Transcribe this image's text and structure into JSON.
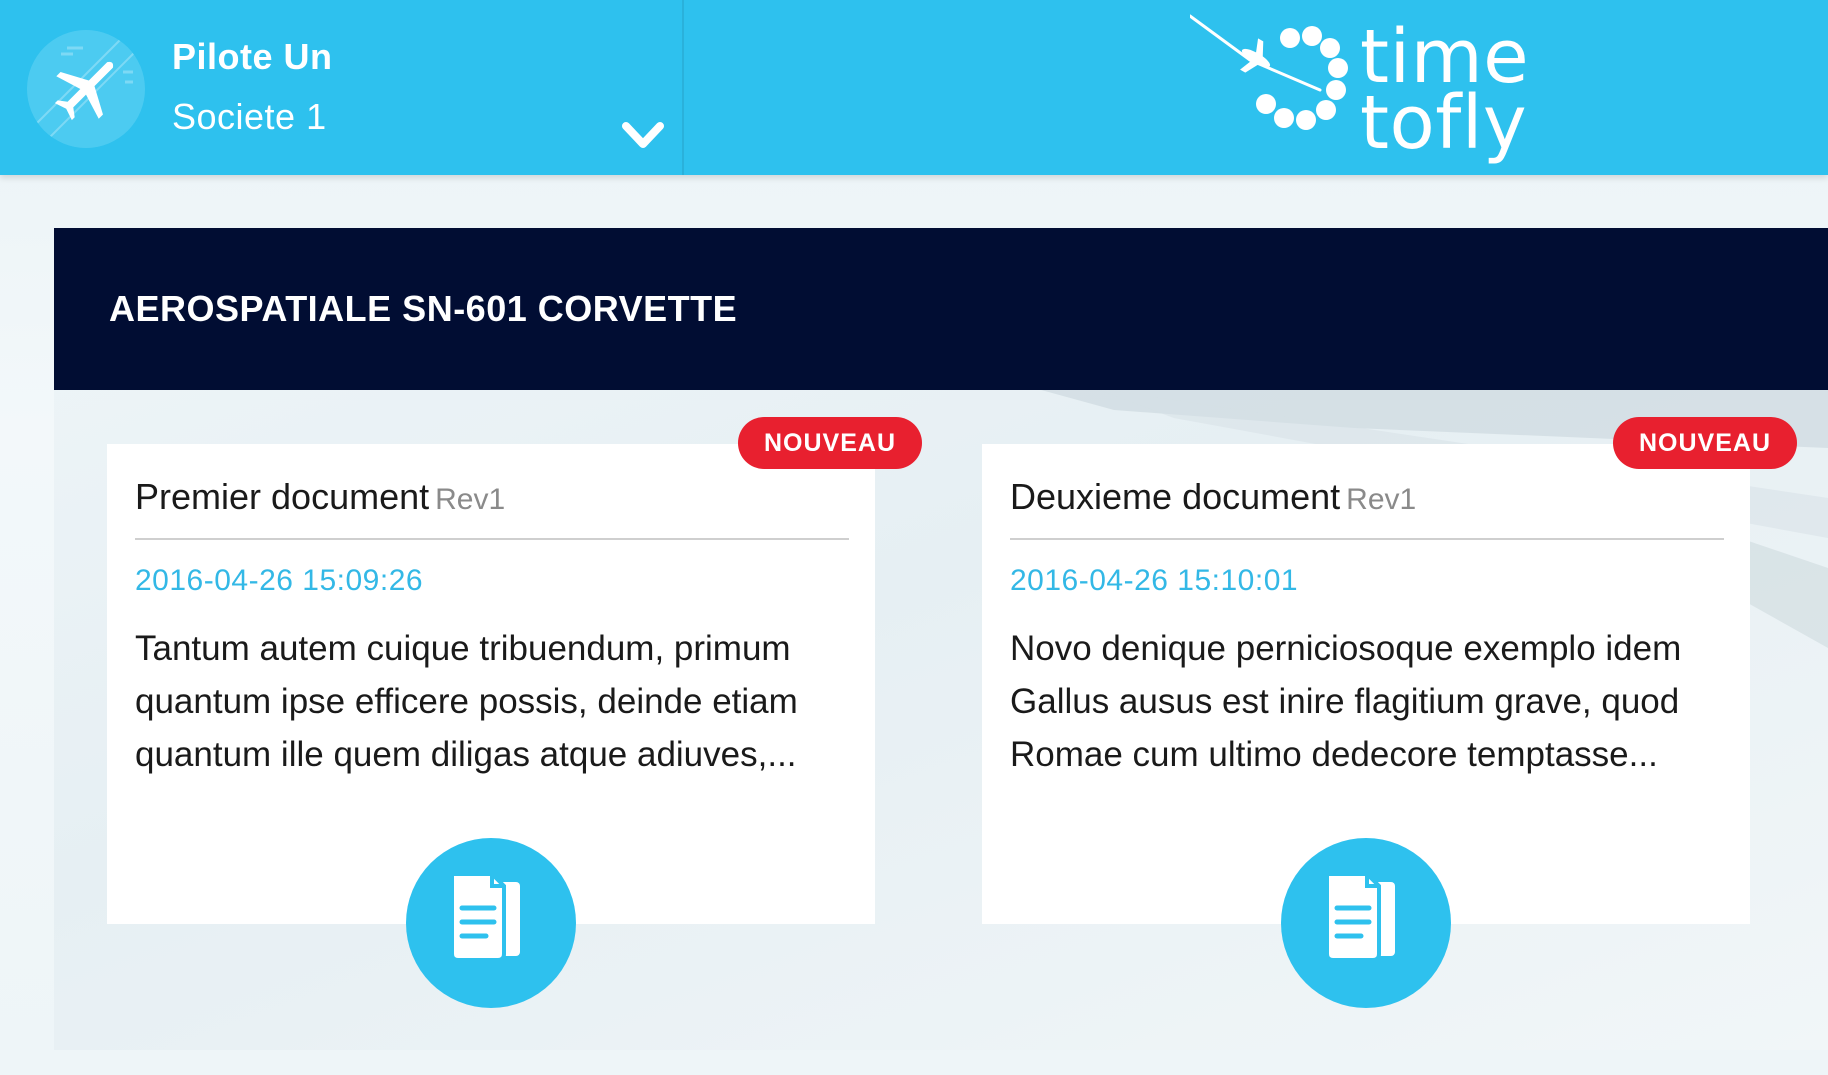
{
  "header": {
    "user_name": "Pilote Un",
    "company": "Societe 1",
    "brand_line1": "time",
    "brand_line2": "tofly",
    "accent_color": "#2ec1ee"
  },
  "section": {
    "title": "AEROSPATIALE SN-601 CORVETTE",
    "header_color": "#010d33"
  },
  "documents": [
    {
      "badge": "NOUVEAU",
      "title": "Premier document",
      "revision": "Rev1",
      "date": "2016-04-26 15:09:26",
      "excerpt": "Tantum autem cuique tribuendum, primum quantum ipse efficere possis, deinde etiam quantum ille quem diligas atque adiuves,...",
      "icon": "document-icon"
    },
    {
      "badge": "NOUVEAU",
      "title": "Deuxieme document",
      "revision": "Rev1",
      "date": "2016-04-26 15:10:01",
      "excerpt": "Novo denique perniciosoque exemplo idem Gallus ausus est inire flagitium grave, quod Romae cum ultimo dedecore temptasse...",
      "icon": "document-icon"
    }
  ],
  "colors": {
    "badge": "#e8202f",
    "date": "#33b8e6"
  }
}
